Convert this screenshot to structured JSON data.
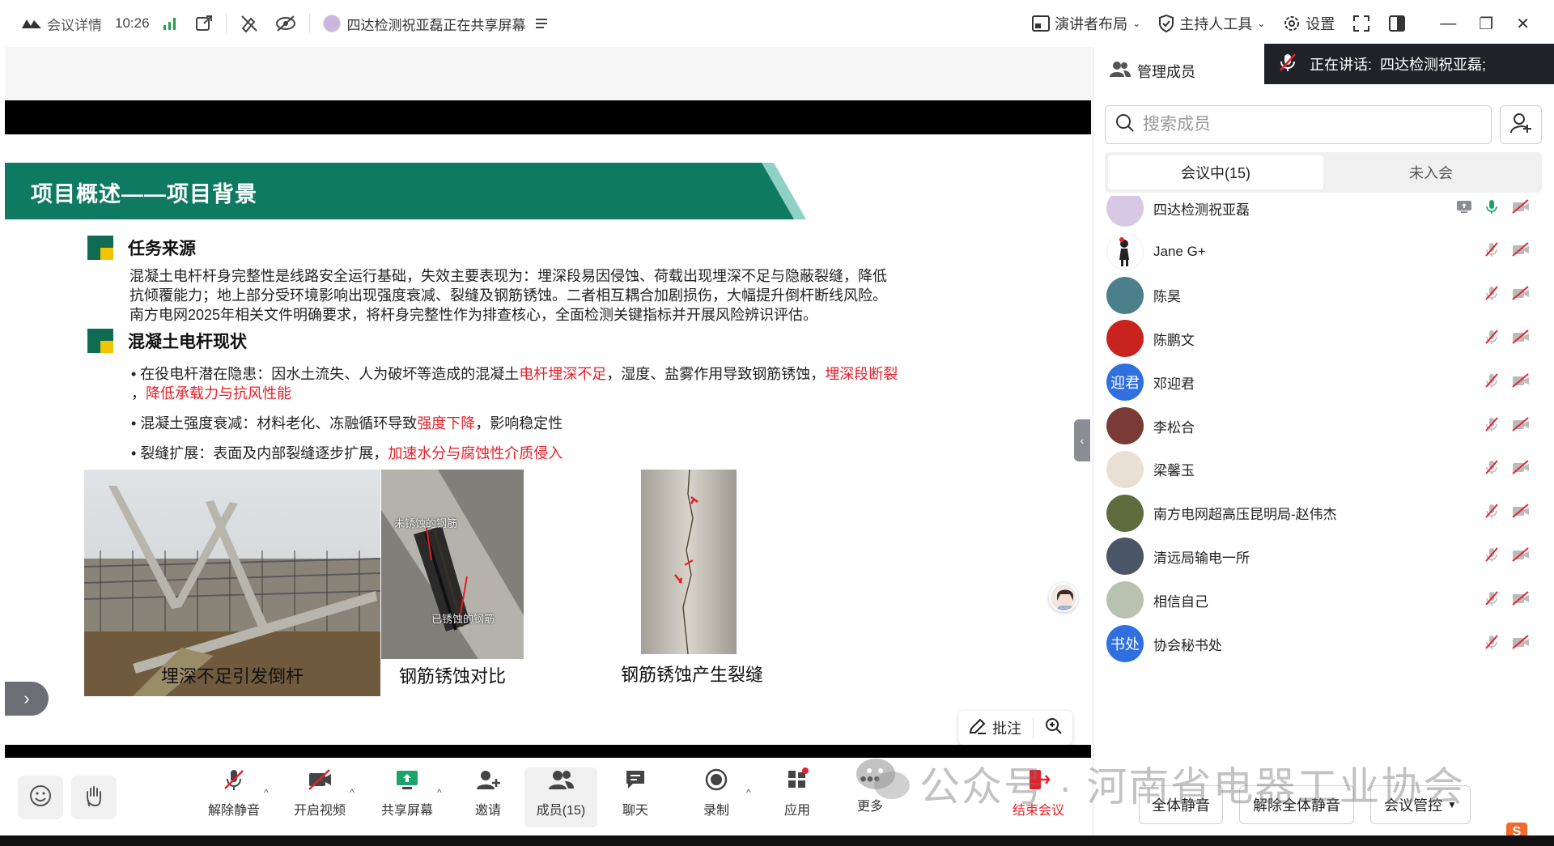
{
  "topbar": {
    "meeting_info_label": "会议详情",
    "time": "10:26",
    "sharing_label": "四达检测祝亚磊正在共享屏幕",
    "presenter_layout_label": "演讲者布局",
    "host_tools_label": "主持人工具",
    "settings_label": "设置"
  },
  "slide": {
    "title": "项目概述——项目背景",
    "section1_title": "任务来源",
    "section1_lines": [
      "混凝土电杆杆身完整性是线路安全运行基础，失效主要表现为：埋深段易因侵蚀、荷载出现埋深不足与隐蔽裂缝，降低",
      "抗倾覆能力；地上部分受环境影响出现强度衰减、裂缝及钢筋锈蚀。二者相互耦合加剧损伤，大幅提升倒杆断线风险。",
      "南方电网2025年相关文件明确要求，将杆身完整性作为排查核心，全面检测关键指标并开展风险辨识评估。"
    ],
    "section2_title": "混凝土电杆现状",
    "bullet1_a": "• 在役电杆潜在隐患：因水土流失、人为破坏等造成的混凝土",
    "bullet1_red1": "电杆埋深不足",
    "bullet1_b": "，湿度、盐雾作用导致钢筋锈蚀，",
    "bullet1_red2": "埋深段断裂",
    "bullet1_c": "，",
    "bullet1_red3": "降低承载力与抗风性能",
    "bullet2_a": "• 混凝土强度衰减：材料老化、冻融循环导致",
    "bullet2_red": "强度下降",
    "bullet2_b": "，影响稳定性",
    "bullet3_a": "• 裂缝扩展：表面及内部裂缝逐步扩展，",
    "bullet3_red": "加速水分与腐蚀性介质侵入",
    "photo2_label_top": "未锈蚀的钢筋",
    "photo2_label_bottom": "已锈蚀的钢筋",
    "captions": [
      "埋深不足引发倒杆",
      "钢筋锈蚀对比",
      "钢筋锈蚀产生裂缝"
    ],
    "annotate_label": "批注"
  },
  "bottombar": {
    "unmute": "解除静音",
    "start_video": "开启视频",
    "share_screen": "共享屏幕",
    "invite": "邀请",
    "members": "成员(15)",
    "chat": "聊天",
    "record": "录制",
    "apps": "应用",
    "more": "更多",
    "end_meeting": "结束会议"
  },
  "panel": {
    "title": "管理成员",
    "speaking_label": "正在讲话:",
    "speaking_name": "四达检测祝亚磊;",
    "search_placeholder": "搜索成员",
    "tab_in_meeting": "会议中(15)",
    "tab_not_joined": "未入会",
    "members": [
      {
        "name": "四达检测祝亚磊",
        "avatar_text": "",
        "avatar_color": "#d8c8e6"
      },
      {
        "name": "Jane G+",
        "avatar_text": "",
        "avatar_color": "#ffffff"
      },
      {
        "name": "陈昊",
        "avatar_text": "",
        "avatar_color": "#4b7f8c"
      },
      {
        "name": "陈鹏文",
        "avatar_text": "",
        "avatar_color": "#c8231f"
      },
      {
        "name": "邓迎君",
        "avatar_text": "迎君",
        "avatar_color": "#2f6fe0"
      },
      {
        "name": "李松合",
        "avatar_text": "",
        "avatar_color": "#7a3a36"
      },
      {
        "name": "梁馨玉",
        "avatar_text": "",
        "avatar_color": "#e9dfd4"
      },
      {
        "name": "南方电网超高压昆明局-赵伟杰",
        "avatar_text": "",
        "avatar_color": "#5e6b3c"
      },
      {
        "name": "清远局输电一所",
        "avatar_text": "",
        "avatar_color": "#4a5566"
      },
      {
        "name": "相信自己",
        "avatar_text": "",
        "avatar_color": "#b9c2b0"
      },
      {
        "name": "协会秘书处",
        "avatar_text": "书处",
        "avatar_color": "#2f6fe0"
      }
    ],
    "mute_all": "全体静音",
    "unmute_all": "解除全体静音",
    "meeting_control": "会议管控"
  },
  "watermark": {
    "text": "公众号 · 河南省电器工业协会"
  }
}
